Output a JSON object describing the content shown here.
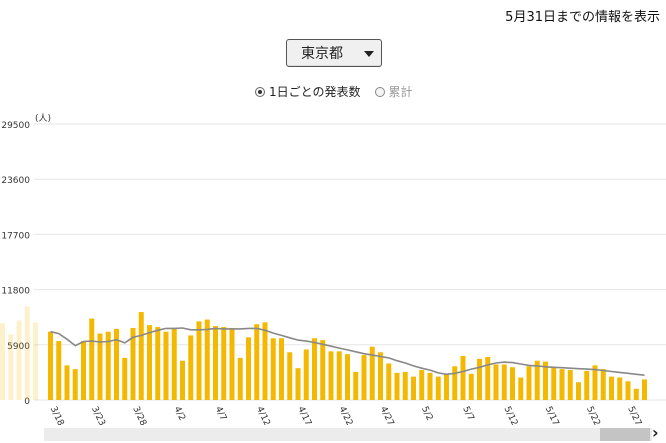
{
  "header": {
    "info_text": "5月31日までの情報を表示"
  },
  "prefecture_select": {
    "selected": "東京都"
  },
  "mode": {
    "daily_label": "1日ごとの発表数",
    "cumulative_label": "累計",
    "selected": "daily"
  },
  "colors": {
    "bar": "#f5b800",
    "line": "#888888",
    "grid": "#e6e6e6"
  },
  "icons": {
    "dropdown": "triangle-down",
    "scroll_right": "chevron-right"
  },
  "chart_data": {
    "type": "bar",
    "unit_label": "(人)",
    "ylim": [
      0,
      29500
    ],
    "yticks": [
      0,
      5900,
      11800,
      17700,
      23600,
      29500
    ],
    "ytick_labels": [
      "0",
      "5900",
      "11800",
      "17700",
      "23600",
      "29500"
    ],
    "xtick_labels": [
      "3/18",
      "3/23",
      "3/28",
      "4/2",
      "4/7",
      "4/12",
      "4/17",
      "4/22",
      "4/27",
      "5/2",
      "5/7",
      "5/12",
      "5/17",
      "5/22",
      "5/27"
    ],
    "x_start_date": "3/18",
    "series": [
      {
        "type": "bar",
        "values": [
          7300,
          6300,
          3700,
          3300,
          6300,
          8700,
          7100,
          7300,
          7600,
          4500,
          7700,
          9400,
          8000,
          7800,
          7300,
          7700,
          4200,
          6900,
          8400,
          8600,
          7900,
          7800,
          7700,
          4500,
          6700,
          8100,
          8300,
          6600,
          6600,
          5100,
          3400,
          5400,
          6600,
          6400,
          5200,
          5200,
          4900,
          3000,
          4800,
          5700,
          5100,
          3900,
          2900,
          3000,
          2500,
          3200,
          2900,
          2500,
          2800,
          3600,
          4700,
          2800,
          4400,
          4600,
          3800,
          3800,
          3500,
          2400,
          3600,
          4200,
          4100,
          3500,
          3300,
          3200,
          1900,
          3100,
          3700,
          3300,
          2500,
          2400,
          2000,
          1200,
          2200
        ]
      },
      {
        "type": "line",
        "name": "",
        "values": [
          7300,
          7100,
          6500,
          5800,
          6250,
          6300,
          6200,
          6250,
          6450,
          6100,
          6700,
          6900,
          7200,
          7450,
          7650,
          7650,
          7700,
          7500,
          7500,
          7550,
          7650,
          7600,
          7600,
          7600,
          7650,
          7650,
          7450,
          7150,
          6900,
          6650,
          6400,
          6300,
          6150,
          5950,
          5750,
          5550,
          5350,
          5150,
          4950,
          4800,
          4650,
          4500,
          4200,
          3950,
          3650,
          3400,
          3200,
          2900,
          2750,
          2850,
          3050,
          3300,
          3500,
          3750,
          3950,
          4050,
          4000,
          3850,
          3700,
          3650,
          3550,
          3500,
          3450,
          3400,
          3350,
          3300,
          3250,
          3150,
          3050,
          2950,
          2850,
          2750,
          2650
        ]
      }
    ],
    "ghost_values": [
      8200,
      7000,
      8500,
      10000,
      8300
    ]
  }
}
